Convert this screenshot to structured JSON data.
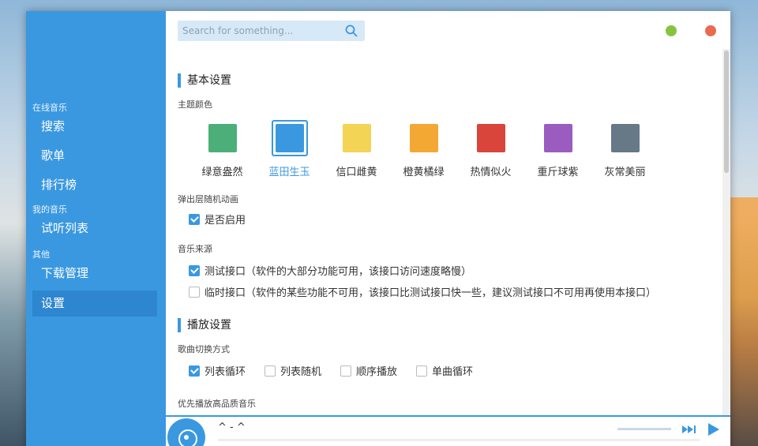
{
  "search": {
    "placeholder": "Search for something..."
  },
  "sidebar": {
    "groups": [
      {
        "title": "在线音乐",
        "items": [
          {
            "label": "搜索"
          },
          {
            "label": "歌单"
          },
          {
            "label": "排行榜"
          }
        ]
      },
      {
        "title": "我的音乐",
        "items": [
          {
            "label": "试听列表"
          }
        ]
      },
      {
        "title": "其他",
        "items": [
          {
            "label": "下载管理"
          },
          {
            "label": "设置"
          }
        ]
      }
    ],
    "active": "设置"
  },
  "settings": {
    "basic": {
      "title": "基本设置",
      "theme_label": "主题颜色",
      "colors": [
        {
          "name": "绿意盎然",
          "color": "#4caf7a"
        },
        {
          "name": "蓝田生玉",
          "color": "#3a98e0",
          "selected": true
        },
        {
          "name": "信口雌黄",
          "color": "#f3d455"
        },
        {
          "name": "橙黄橘绿",
          "color": "#f3a833"
        },
        {
          "name": "热情似火",
          "color": "#d9443b"
        },
        {
          "name": "重斤球紫",
          "color": "#9b5cc0"
        },
        {
          "name": "灰常美丽",
          "color": "#677886"
        }
      ],
      "animation_label": "弹出层随机动画",
      "animation_option": "是否启用",
      "source_label": "音乐来源",
      "sources": [
        {
          "label": "测试接口（软件的大部分功能可用，该接口访问速度略慢）",
          "checked": true
        },
        {
          "label": "临时接口（软件的某些功能不可用，该接口比测试接口快一些，建议测试接口不可用再使用本接口）",
          "checked": false
        }
      ]
    },
    "play": {
      "title": "播放设置",
      "switch_label": "歌曲切换方式",
      "switch_options": [
        {
          "label": "列表循环",
          "checked": true
        },
        {
          "label": "列表随机",
          "checked": false
        },
        {
          "label": "顺序播放",
          "checked": false
        },
        {
          "label": "单曲循环",
          "checked": false
        }
      ],
      "hq_label": "优先播放高品质音乐"
    }
  },
  "player": {
    "song": "^ - ^"
  },
  "colors": {
    "accent": "#3a98e0",
    "min_dot": "#86c440",
    "close_dot": "#ea6a4f"
  }
}
